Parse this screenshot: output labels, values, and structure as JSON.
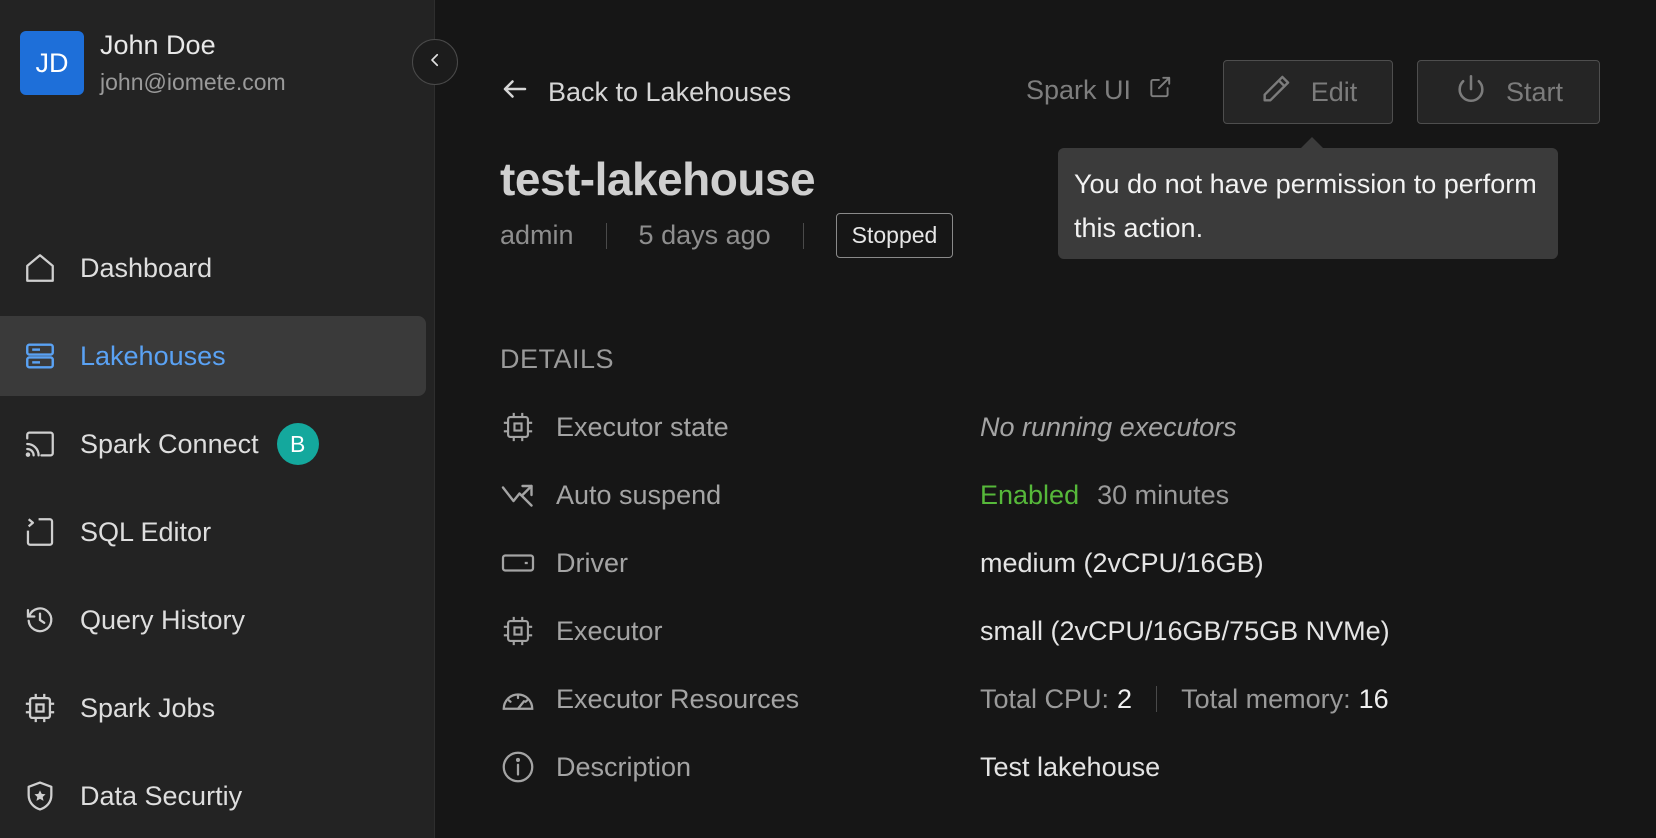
{
  "user": {
    "initials": "JD",
    "name": "John Doe",
    "email": "john@iomete.com"
  },
  "sidebar": {
    "items": [
      {
        "label": "Dashboard",
        "icon": "home-icon"
      },
      {
        "label": "Lakehouses",
        "icon": "server-icon",
        "active": true
      },
      {
        "label": "Spark Connect",
        "icon": "cast-icon",
        "badge": "B"
      },
      {
        "label": "SQL Editor",
        "icon": "code-file-icon"
      },
      {
        "label": "Query History",
        "icon": "history-icon"
      },
      {
        "label": "Spark Jobs",
        "icon": "chip-icon"
      },
      {
        "label": "Data Securtiy",
        "icon": "shield-star-icon"
      }
    ]
  },
  "header": {
    "back_label": "Back to Lakehouses",
    "spark_ui_label": "Spark UI",
    "edit_label": "Edit",
    "start_label": "Start"
  },
  "tooltip": {
    "text": "You do not have permission to perform this action."
  },
  "lakehouse": {
    "name": "test-lakehouse",
    "owner": "admin",
    "created": "5 days ago",
    "status": "Stopped"
  },
  "details": {
    "section_title": "DETAILS",
    "executor_state": {
      "label": "Executor state",
      "value": "No running executors"
    },
    "auto_suspend": {
      "label": "Auto suspend",
      "status": "Enabled",
      "duration": "30 minutes"
    },
    "driver": {
      "label": "Driver",
      "value": "medium (2vCPU/16GB)"
    },
    "executor": {
      "label": "Executor",
      "value": "small (2vCPU/16GB/75GB NVMe)"
    },
    "executor_resources": {
      "label": "Executor Resources",
      "cpu_label": "Total CPU:",
      "cpu_value": "2",
      "memory_label": "Total memory:",
      "memory_value": "16"
    },
    "description": {
      "label": "Description",
      "value": "Test lakehouse"
    }
  },
  "colors": {
    "accent": "#5aa2f4",
    "avatar": "#1e6fd9",
    "badge": "#14a89d",
    "enabled": "#56b83a",
    "background": "#161616",
    "sidebar": "#232323"
  }
}
